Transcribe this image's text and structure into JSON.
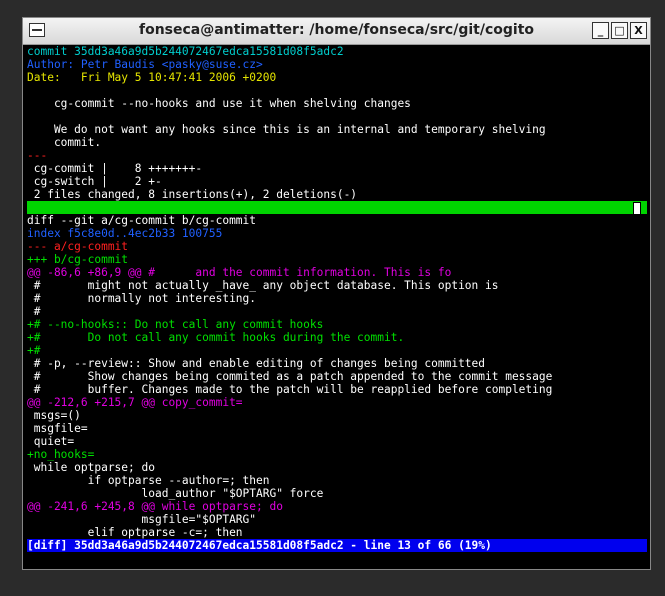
{
  "window": {
    "title": "fonseca@antimatter: /home/fonseca/src/git/cogito",
    "buttons": {
      "minimize": "_",
      "maximize": "□",
      "close": "X"
    }
  },
  "colors": {
    "default": "#ffffff",
    "cyan": "#00cdcd",
    "yellow": "#e5e500",
    "red": "#ff2020",
    "green": "#00e000",
    "blue": "#2060ff",
    "magenta": "#e000e0",
    "green_bar": "#00d400",
    "status_bar": "#0000ee"
  },
  "terminal": {
    "lines": [
      {
        "text": "commit 35dd3a46a9d5b244072467edca15581d08f5adc2",
        "color": "cyan"
      },
      {
        "text": "Author: Petr Baudis <pasky@suse.cz>",
        "color": "blue"
      },
      {
        "text": "Date:   Fri May 5 10:47:41 2006 +0200",
        "color": "yellow"
      },
      {
        "text": "",
        "color": "default"
      },
      {
        "text": "    cg-commit --no-hooks and use it when shelving changes",
        "color": "default"
      },
      {
        "text": "",
        "color": "default"
      },
      {
        "text": "    We do not want any hooks since this is an internal and temporary shelving",
        "color": "default"
      },
      {
        "text": "    commit.",
        "color": "default"
      },
      {
        "text": "---",
        "color": "red"
      },
      {
        "text": " cg-commit |    8 +++++++-",
        "color": "default"
      },
      {
        "text": " cg-switch |    2 +-",
        "color": "default"
      },
      {
        "text": " 2 files changed, 8 insertions(+), 2 deletions(-)",
        "color": "default"
      },
      {
        "text": "",
        "color": "default",
        "style": "green-bar"
      },
      {
        "text": "diff --git a/cg-commit b/cg-commit",
        "color": "default"
      },
      {
        "text": "index f5c8e0d..4ec2b33 100755",
        "color": "blue"
      },
      {
        "text": "--- a/cg-commit",
        "color": "red"
      },
      {
        "text": "+++ b/cg-commit",
        "color": "green"
      },
      {
        "text": "@@ -86,6 +86,9 @@ #      and the commit information. This is fo",
        "color": "magenta"
      },
      {
        "text": " #       might not actually _have_ any object database. This option is",
        "color": "default"
      },
      {
        "text": " #       normally not interesting.",
        "color": "default"
      },
      {
        "text": " #",
        "color": "default"
      },
      {
        "text": "+# --no-hooks:: Do not call any commit hooks",
        "color": "green"
      },
      {
        "text": "+#       Do not call any commit hooks during the commit.",
        "color": "green"
      },
      {
        "text": "+#",
        "color": "green"
      },
      {
        "text": " # -p, --review:: Show and enable editing of changes being committed",
        "color": "default"
      },
      {
        "text": " #       Show changes being commited as a patch appended to the commit message",
        "color": "default"
      },
      {
        "text": " #       buffer. Changes made to the patch will be reapplied before completing",
        "color": "default"
      },
      {
        "text": "@@ -212,6 +215,7 @@ copy_commit=",
        "color": "magenta"
      },
      {
        "text": " msgs=()",
        "color": "default"
      },
      {
        "text": " msgfile=",
        "color": "default"
      },
      {
        "text": " quiet=",
        "color": "default"
      },
      {
        "text": "+no_hooks=",
        "color": "green"
      },
      {
        "text": " while optparse; do",
        "color": "default"
      },
      {
        "text": "         if optparse --author=; then",
        "color": "default"
      },
      {
        "text": "                 load_author \"$OPTARG\" force",
        "color": "default"
      },
      {
        "text": "@@ -241,6 +245,8 @@ while optparse; do",
        "color": "magenta"
      },
      {
        "text": "                 msgfile=\"$OPTARG\"",
        "color": "default"
      },
      {
        "text": "         elif optparse -c=; then",
        "color": "default"
      }
    ],
    "status_line": "[diff] 35dd3a46a9d5b244072467edca15581d08f5adc2 - line 13 of 66 (19%)"
  }
}
